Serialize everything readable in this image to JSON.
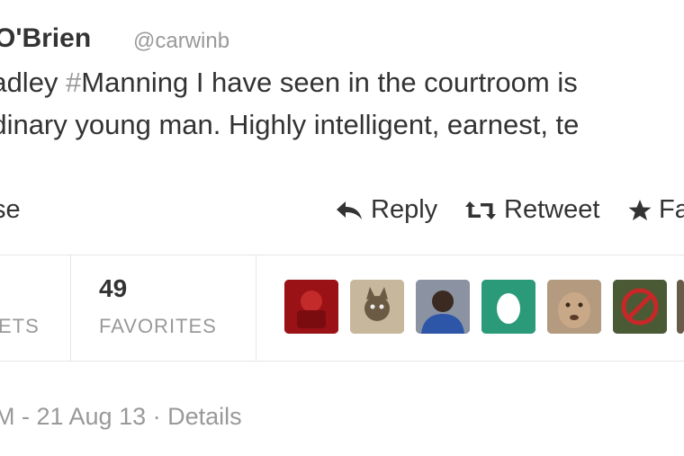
{
  "tweet": {
    "author_name": "O'Brien",
    "author_handle": "@carwinb",
    "line1_pre": "radley ",
    "line1_hash": "#",
    "line1_tag": "Manning",
    "line1_post": " I have seen in the courtroom is",
    "line2": "rdinary young man.  Highly intelligent, earnest, te"
  },
  "actions": {
    "collapse_label": "se",
    "reply_label": "Reply",
    "retweet_label": "Retweet",
    "favorite_label": "Fa"
  },
  "stats": {
    "retweets_label": "ETS",
    "favorites_count": "49",
    "favorites_label": "FAVORITES"
  },
  "avatars": [
    {
      "name": "avatar-red",
      "color": "#b0181c"
    },
    {
      "name": "avatar-cat",
      "color": "#b9a78c"
    },
    {
      "name": "avatar-man",
      "color": "#3a4a6a"
    },
    {
      "name": "avatar-egg",
      "color": "#2a9b7a"
    },
    {
      "name": "avatar-cougar",
      "color": "#a08870"
    },
    {
      "name": "avatar-nosymbol",
      "color": "#3b4a2a"
    }
  ],
  "footer": {
    "timestamp": "M - 21 Aug 13",
    "separator": "·",
    "details_label": "Details"
  },
  "icons": {
    "reply": "reply-arrow-icon",
    "retweet": "retweet-icon",
    "favorite": "star-icon"
  }
}
